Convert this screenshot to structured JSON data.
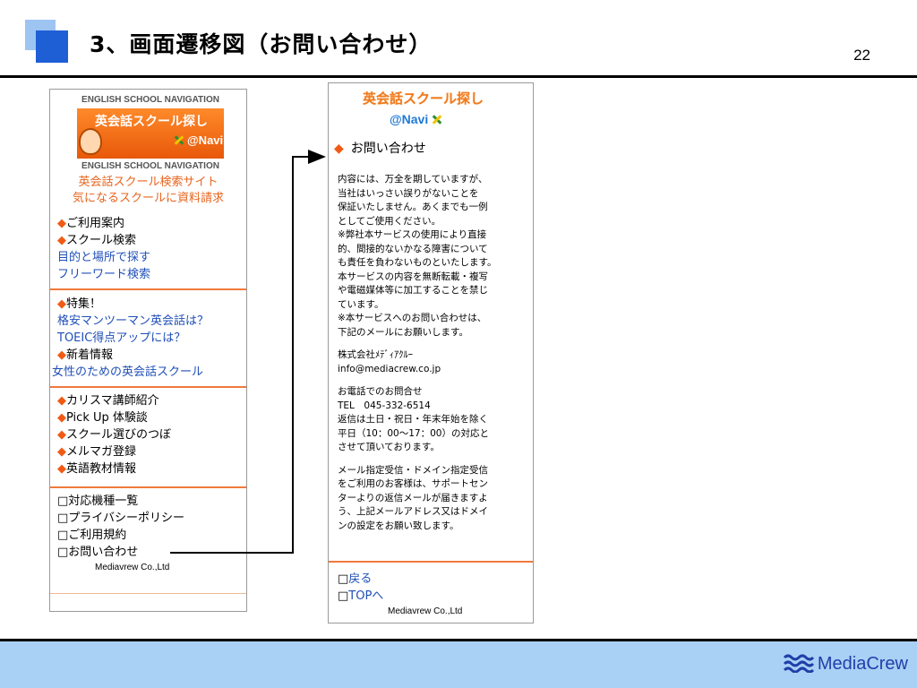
{
  "slide": {
    "title": "3、画面遷移図（お問い合わせ）",
    "page_number": "22",
    "brand": "MediaCrew"
  },
  "left_phone": {
    "logo": {
      "eng_top": "ENGLISH SCHOOL NAVIGATION",
      "jp_name": "英会話スクール探し",
      "navi": "@Navi",
      "eng_bottom": "ENGLISH SCHOOL NAVIGATION"
    },
    "tagline": [
      "英会話スクール検索サイト",
      "気になるスクールに資料請求"
    ],
    "section1": [
      {
        "type": "orange",
        "label": "ご利用案内"
      },
      {
        "type": "orange",
        "label": "スクール検索"
      },
      {
        "type": "link",
        "label": "目的と場所で探す"
      },
      {
        "type": "link",
        "label": "フリーワード検索"
      }
    ],
    "section2": [
      {
        "type": "orange",
        "label": "特集！"
      },
      {
        "type": "link",
        "label": "格安マンツーマン英会話は？"
      },
      {
        "type": "link",
        "label": "TOEIC得点アップには？"
      },
      {
        "type": "orange",
        "label": "新着情報"
      },
      {
        "type": "link",
        "label": "女性のための英会話スクール"
      }
    ],
    "section3": [
      {
        "type": "orange",
        "label": "カリスマ講師紹介"
      },
      {
        "type": "orange",
        "label": "Pick Up 体験談"
      },
      {
        "type": "orange",
        "label": "スクール選びのつぼ"
      },
      {
        "type": "orange",
        "label": "メルマガ登録"
      },
      {
        "type": "orange",
        "label": "英語教材情報"
      }
    ],
    "section4": [
      {
        "type": "sq",
        "label": "対応機種一覧"
      },
      {
        "type": "sq",
        "label": "プライバシーポリシー"
      },
      {
        "type": "sq",
        "label": "ご利用規約"
      },
      {
        "type": "sq",
        "label": "お問い合わせ"
      }
    ],
    "footer": "Mediavrew Co.,Ltd"
  },
  "right_phone": {
    "logo": {
      "jp_name": "英会話スクール探し",
      "navi": "@Navi"
    },
    "heading": "お問い合わせ",
    "body_lines": [
      "内容には、万全を期していますが、",
      "当社はいっさい誤りがないことを",
      "保証いたしません。あくまでも一例",
      "としてご使用ください。",
      "※弊社本サービスの使用により直接",
      "的、間接的ないかなる障害について",
      "も責任を負わないものといたします。",
      "本サービスの内容を無断転載・複写",
      "や電磁媒体等に加工することを禁じ",
      "ています。",
      "※本サービスへのお問い合わせは、",
      "下記のメールにお願いします。",
      "",
      "株式会社ﾒﾃﾞｨｱｸﾙｰ",
      "info@mediacrew.co.jp",
      "",
      "お電話でのお問合せ",
      "TEL　045-332-6514",
      "返信は土日・祝日・年末年始を除く",
      "平日（10：00〜17：00）の対応と",
      "させて頂いております。",
      "",
      "メール指定受信・ドメイン指定受信",
      "をご利用のお客様は、サポートセン",
      "ターよりの返信メールが届きますよ",
      "う、上記メールアドレス又はドメイ",
      "ンの設定をお願い致します。"
    ],
    "nav": [
      {
        "label": "戻る"
      },
      {
        "label": "TOPへ"
      }
    ],
    "footer": "Mediavrew Co.,Ltd"
  }
}
